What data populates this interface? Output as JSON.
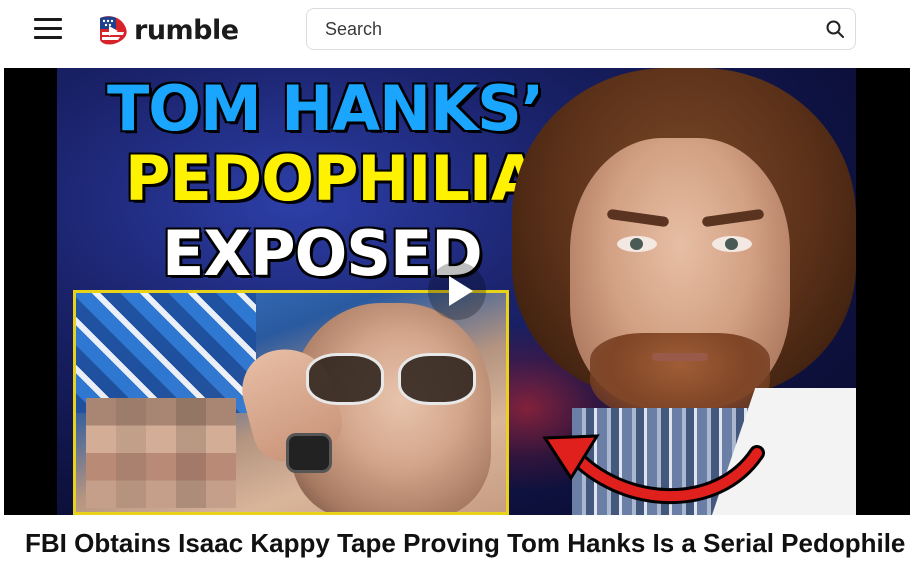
{
  "header": {
    "menu_icon": "hamburger-menu-icon",
    "logo": {
      "text": "rumble",
      "icon": "rumble-flag-play-logo-icon"
    },
    "search": {
      "placeholder": "Search",
      "value": "",
      "icon": "search-icon"
    }
  },
  "video": {
    "thumbnail": {
      "headline_line1": "TOM HANKS’",
      "headline_line2": "PEDOPHILIA",
      "headline_line3": "EXPOSED",
      "headline_colors": [
        "#1aa6ff",
        "#fff200",
        "#ffffff"
      ],
      "inset_border_color": "#e8d21a",
      "arrow_color": "#e0201c"
    },
    "play_icon": "play-icon",
    "title": "FBI Obtains Isaac Kappy Tape Proving Tom Hanks Is a Serial Pedophile"
  }
}
